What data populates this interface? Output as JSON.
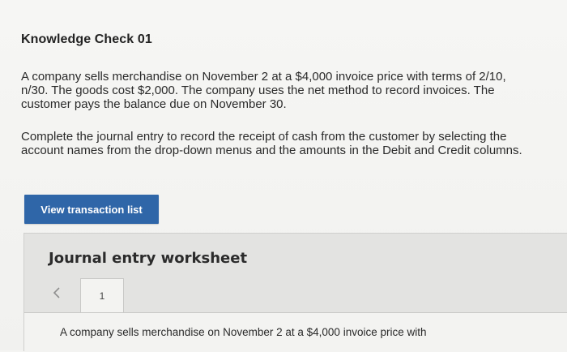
{
  "question": {
    "title": "Knowledge Check 01",
    "paragraph1": "A company sells merchandise on November 2 at a $4,000 invoice price with terms of 2/10, n/30. The goods cost $2,000. The company uses the net method to record invoices. The customer pays the balance due on November 30.",
    "paragraph2": "Complete the journal entry to record the receipt of cash from the customer by selecting the account names from the drop-down menus and the amounts in the Debit and Credit columns."
  },
  "actions": {
    "view_transaction_list_label": "View transaction list"
  },
  "worksheet": {
    "title": "Journal entry worksheet",
    "prev_icon": "chevron-left-icon",
    "active_tab": "1",
    "description": "A company sells merchandise on November 2 at a $4,000 invoice price with"
  },
  "colors": {
    "button_blue": "#2f66a8",
    "background": "#f4f4f2",
    "worksheet_bg": "#e3e3e1"
  }
}
